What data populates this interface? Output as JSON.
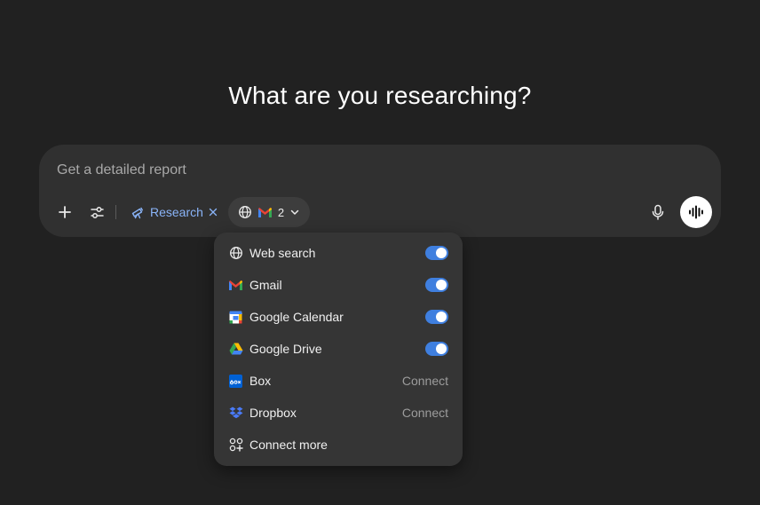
{
  "heading": "What are you researching?",
  "composer": {
    "placeholder": "Get a detailed report",
    "research_label": "Research",
    "sources_count": "2"
  },
  "menu": {
    "items": [
      {
        "label": "Web search",
        "icon": "globe-icon",
        "state": "on"
      },
      {
        "label": "Gmail",
        "icon": "gmail-icon",
        "state": "on"
      },
      {
        "label": "Google Calendar",
        "icon": "google-calendar-icon",
        "state": "on"
      },
      {
        "label": "Google Drive",
        "icon": "google-drive-icon",
        "state": "on"
      },
      {
        "label": "Box",
        "icon": "box-icon",
        "action": "Connect"
      },
      {
        "label": "Dropbox",
        "icon": "dropbox-icon",
        "action": "Connect"
      },
      {
        "label": "Connect more",
        "icon": "apps-add-icon"
      }
    ]
  },
  "colors": {
    "background": "#212121",
    "composer": "#303030",
    "menu": "#353535",
    "accent_blue": "#8ab4f8",
    "toggle_on": "#3f7fdf"
  }
}
